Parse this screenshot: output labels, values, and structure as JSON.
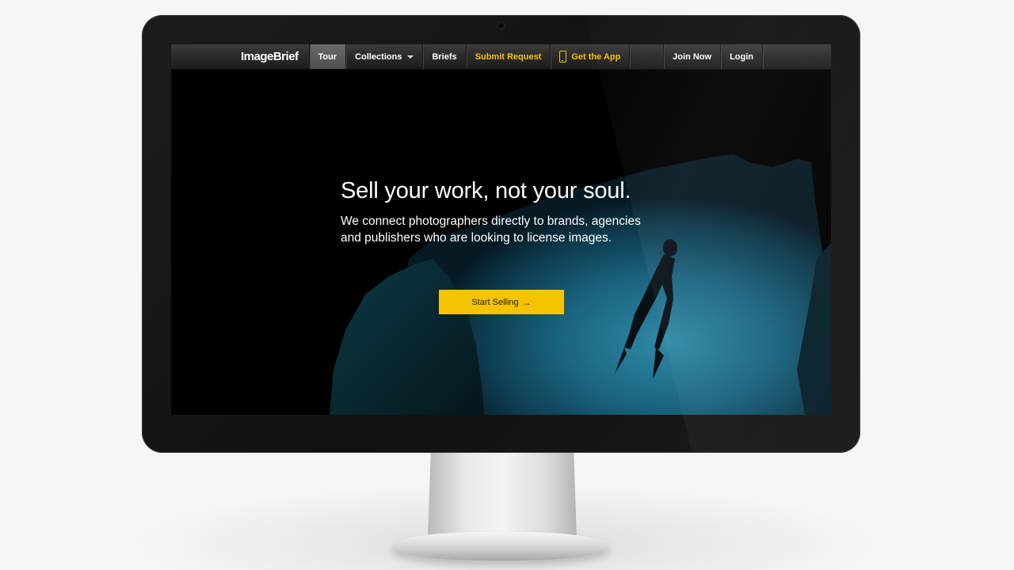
{
  "site": {
    "logo": "ImageBrief"
  },
  "nav": {
    "tour": "Tour",
    "collections": "Collections",
    "briefs": "Briefs",
    "submit_request": "Submit Request",
    "get_app": "Get the App",
    "join": "Join Now",
    "login": "Login"
  },
  "hero": {
    "headline": "Sell your work, not your soul.",
    "subtext": "We connect photographers directly to brands, agencies\nand publishers who are looking to license images.",
    "cta_label": "Start Selling",
    "cta_arrow": "→"
  },
  "device": {
    "logo_glyph": ""
  },
  "colors": {
    "accent": "#f5c400",
    "navbar": "#2a2a2a",
    "bezel": "#141414",
    "water": "#1f6c85"
  },
  "icons": {
    "collections_menu": "caret-down-icon",
    "get_app": "phone-icon",
    "cta": "arrow-right-icon",
    "device": "apple-logo-icon"
  }
}
